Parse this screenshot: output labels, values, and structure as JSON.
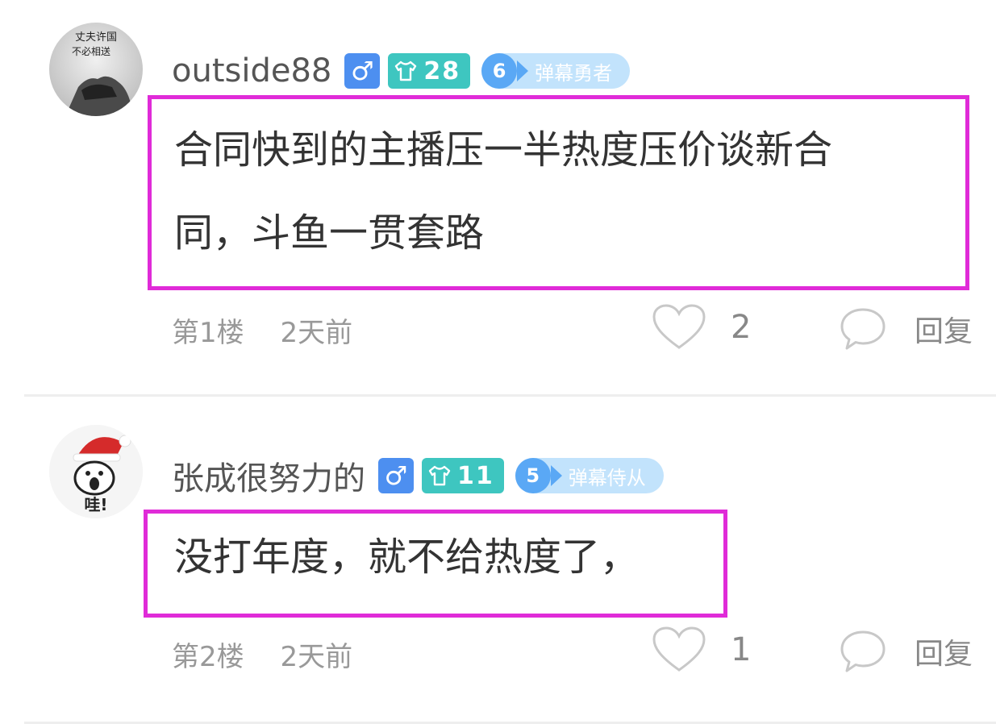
{
  "comments": [
    {
      "username": "outside88",
      "gender_symbol": "♂",
      "fan_level": "28",
      "rank_level": "6",
      "rank_title": "弹幕勇者",
      "content_lines": [
        "合同快到的主播压一半热度压价谈新合",
        "同，斗鱼一贯套路"
      ],
      "floor": "第1楼",
      "time": "2天前",
      "likes": "2",
      "reply_label": "回复",
      "avatar_text": [
        "丈夫许国",
        "不必相送"
      ]
    },
    {
      "username": "张成很努力的",
      "gender_symbol": "♂",
      "fan_level": "11",
      "rank_level": "5",
      "rank_title": "弹幕侍从",
      "content_lines": [
        "没打年度，就不给热度了，"
      ],
      "floor": "第2楼",
      "time": "2天前",
      "likes": "1",
      "reply_label": "回复",
      "avatar_text": [
        "哇!"
      ]
    }
  ],
  "colors": {
    "highlight_border": "#e02bd8",
    "gender_badge": "#4d8ff0",
    "fan_badge": "#3ec6c0",
    "rank_badge": "#5aa8f5",
    "rank_badge_bg": "#c2e3fc"
  }
}
